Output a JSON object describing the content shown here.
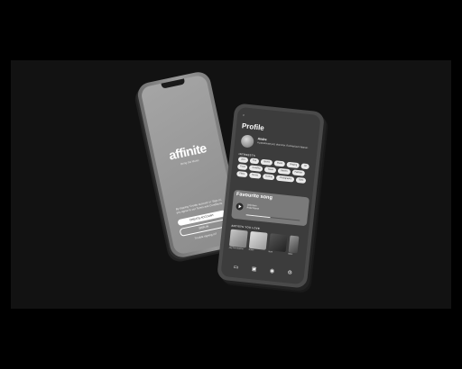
{
  "landing": {
    "brand": "affinite",
    "tagline": "Bring the Music",
    "terms": "By tapping 'Create account' or 'Sign in', you agree to our Terms and Conditions.",
    "create_account": "CREATE ACCOUNT",
    "sign_in": "SIGN IN",
    "trouble": "Trouble signing in?"
  },
  "profile": {
    "back": "‹",
    "title": "Profile",
    "user_name": "Andre",
    "user_bio": "A passionate jazz drummer. Evolved jazz listener.",
    "interests_label": "INTERESTS",
    "interests": [
      "Jazz",
      "Pop",
      "Sports",
      "Music",
      "Singing",
      "Art",
      "Food",
      "Reading",
      "Travel",
      "Games",
      "Fashion",
      "Films",
      "Tennis",
      "Cycling",
      "Photography",
      "Style"
    ],
    "favourite_label": "Favourite song",
    "song_title": "Unknown",
    "song_artist": "Artist Name",
    "song_progress": 0.45,
    "artists_label": "ARTISTS YOU LOVE",
    "artists": [
      {
        "name": "Jay Dee Quartet"
      },
      {
        "name": "Robin"
      },
      {
        "name": "Noel"
      },
      {
        "name": "Bass"
      }
    ],
    "nav_icons": [
      "chat-icon",
      "card-icon",
      "user-icon",
      "settings-icon"
    ]
  }
}
